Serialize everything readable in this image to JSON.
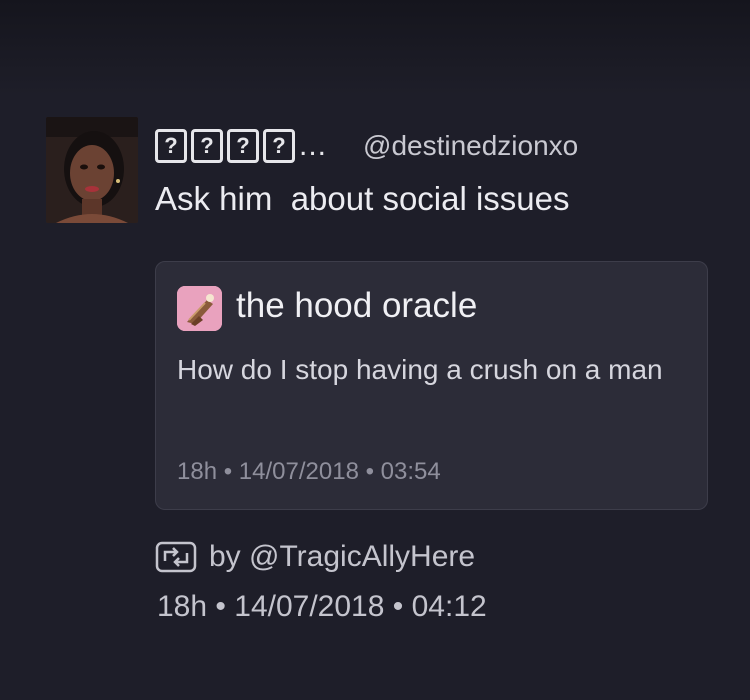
{
  "tweet": {
    "display_name_glyphs": [
      "?",
      "?",
      "?",
      "?"
    ],
    "name_ellipsis": "...",
    "handle": "@destinedzionxo",
    "text": "Ask him  about social issues"
  },
  "quoted": {
    "name": "the hood oracle",
    "text": "How do I stop having a crush on a man",
    "age": "18h",
    "date": "14/07/2018",
    "time": "03:54",
    "separator": "•"
  },
  "retweet": {
    "icon": "retweet-icon",
    "by_text": "by @TragicAllyHere"
  },
  "footer": {
    "age": "18h",
    "date": "14/07/2018",
    "time": "04:12",
    "separator": "•"
  },
  "colors": {
    "background": "#1e1e29",
    "card": "#2c2c38",
    "quote_avatar": "#e9a2be"
  }
}
